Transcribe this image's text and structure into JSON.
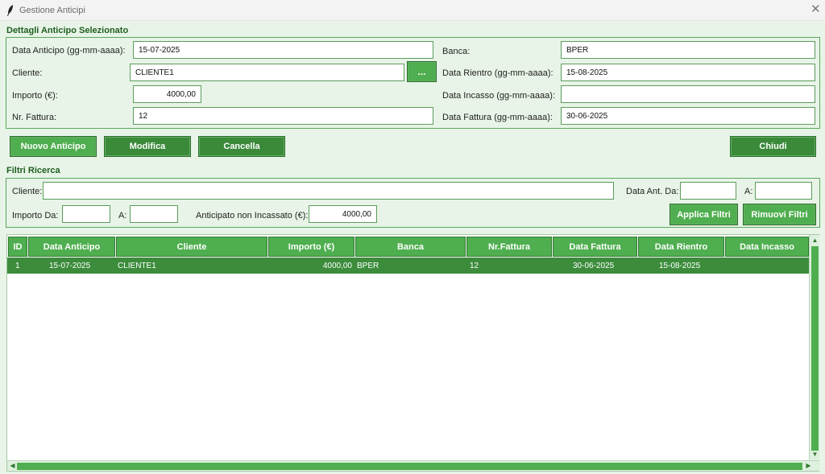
{
  "window": {
    "title": "Gestione Anticipi",
    "close_glyph": "✕",
    "app_icon": "feather-icon"
  },
  "details": {
    "section_title": "Dettagli Anticipo Selezionato",
    "labels": {
      "data_anticipo": "Data Anticipo (gg-mm-aaaa):",
      "cliente": "Cliente:",
      "importo": "Importo (€):",
      "nr_fattura": "Nr. Fattura:",
      "banca": "Banca:",
      "data_rientro": "Data Rientro (gg-mm-aaaa):",
      "data_incasso": "Data Incasso (gg-mm-aaaa):",
      "data_fattura": "Data Fattura (gg-mm-aaaa):"
    },
    "values": {
      "data_anticipo": "15-07-2025",
      "cliente": "CLIENTE1",
      "importo": "4000,00",
      "nr_fattura": "12",
      "banca": "BPER",
      "data_rientro": "15-08-2025",
      "data_incasso": "",
      "data_fattura": "30-06-2025"
    },
    "browse_button": "..."
  },
  "actions": {
    "nuovo": "Nuovo Anticipo",
    "modifica": "Modifica",
    "cancella": "Cancella",
    "chiudi": "Chiudi"
  },
  "filters": {
    "section_title": "Filtri Ricerca",
    "labels": {
      "cliente": "Cliente:",
      "data_ant_da": "Data Ant. Da:",
      "data_ant_a": "A:",
      "importo_da": "Importo Da:",
      "importo_a": "A:",
      "anticipato_non_incassato": "Anticipato non Incassato (€):"
    },
    "values": {
      "cliente": "",
      "data_ant_da": "",
      "data_ant_a": "",
      "importo_da": "",
      "importo_a": "",
      "anticipato_non_incassato": "4000,00"
    },
    "applica": "Applica Filtri",
    "rimuovi": "Rimuovi Filtri"
  },
  "table": {
    "columns": [
      "ID",
      "Data Anticipo",
      "Cliente",
      "Importo (€)",
      "Banca",
      "Nr.Fattura",
      "Data Fattura",
      "Data Rientro",
      "Data Incasso"
    ],
    "rows": [
      [
        "1",
        "15-07-2025",
        "CLIENTE1",
        "4000,00",
        "BPER",
        "12",
        "30-06-2025",
        "15-08-2025",
        ""
      ]
    ]
  }
}
